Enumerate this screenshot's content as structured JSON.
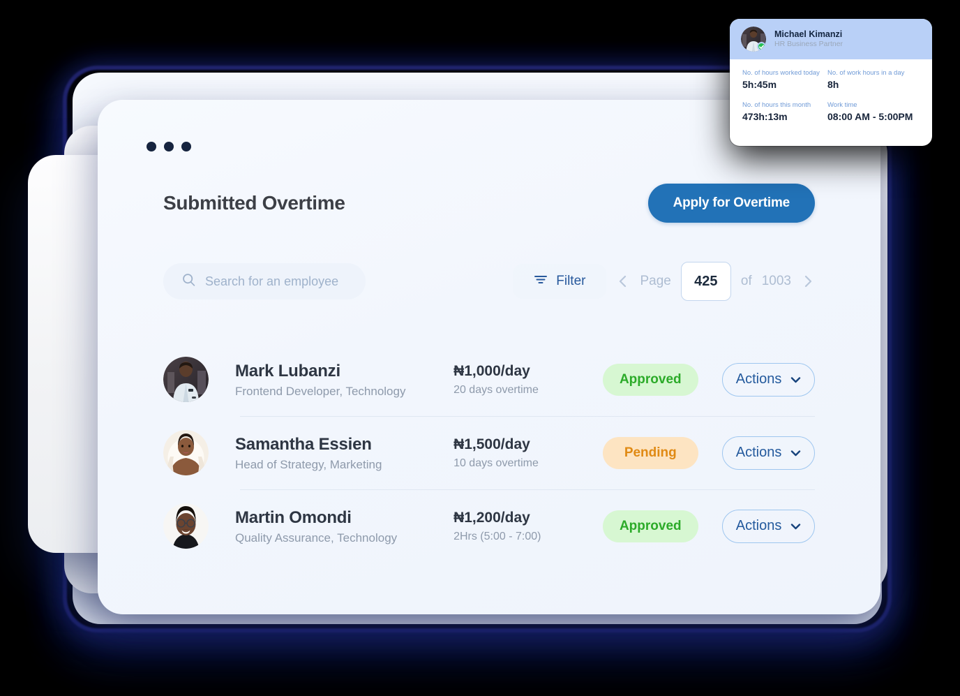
{
  "window": {
    "dots_count": 3
  },
  "header": {
    "title": "Submitted Overtime",
    "apply_button": "Apply for Overtime"
  },
  "search": {
    "placeholder": "Search for an employee",
    "value": ""
  },
  "toolbar": {
    "filter_label": "Filter",
    "page_label": "Page",
    "page_value": "425",
    "of_label": "of",
    "total_pages": "1003",
    "prev_icon": "chevron-left-icon",
    "next_icon": "chevron-right-icon",
    "filter_icon": "filter-icon",
    "search_icon": "search-icon"
  },
  "colors": {
    "accent_blue": "#2272b7",
    "approved_bg": "#d7f7d2",
    "approved_text": "#2cab29",
    "pending_bg": "#fde4c2",
    "pending_text": "#e08a14",
    "card_bg": "#f4f8fd",
    "profile_header_bg": "#b9d0f7",
    "online_green": "#25c054"
  },
  "rows": [
    {
      "name": "Mark Lubanzi",
      "role": "Frontend Developer, Technology",
      "amount": "₦1,000/day",
      "detail": "20 days overtime",
      "status": "Approved",
      "status_kind": "approved",
      "action_label": "Actions",
      "avatar": "photo-mark-lubanzi"
    },
    {
      "name": "Samantha Essien",
      "role": "Head of Strategy, Marketing",
      "amount": "₦1,500/day",
      "detail": "10 days overtime",
      "status": "Pending",
      "status_kind": "pending",
      "action_label": "Actions",
      "avatar": "photo-samantha-essien"
    },
    {
      "name": "Martin Omondi",
      "role": "Quality Assurance, Technology",
      "amount": "₦1,200/day",
      "detail": "2Hrs (5:00 - 7:00)",
      "status": "Approved",
      "status_kind": "approved",
      "action_label": "Actions",
      "avatar": "photo-martin-omondi"
    }
  ],
  "profile_card": {
    "name": "Michael Kimanzi",
    "role": "HR Business Partner",
    "online": true,
    "stats": [
      {
        "label": "No. of hours  worked  today",
        "value": "5h:45m"
      },
      {
        "label": "No. of work hours in a day",
        "value": "8h"
      },
      {
        "label": "No. of hours this month",
        "value": "473h:13m"
      },
      {
        "label": "Work time",
        "value": "08:00 AM - 5:00PM"
      }
    ]
  }
}
